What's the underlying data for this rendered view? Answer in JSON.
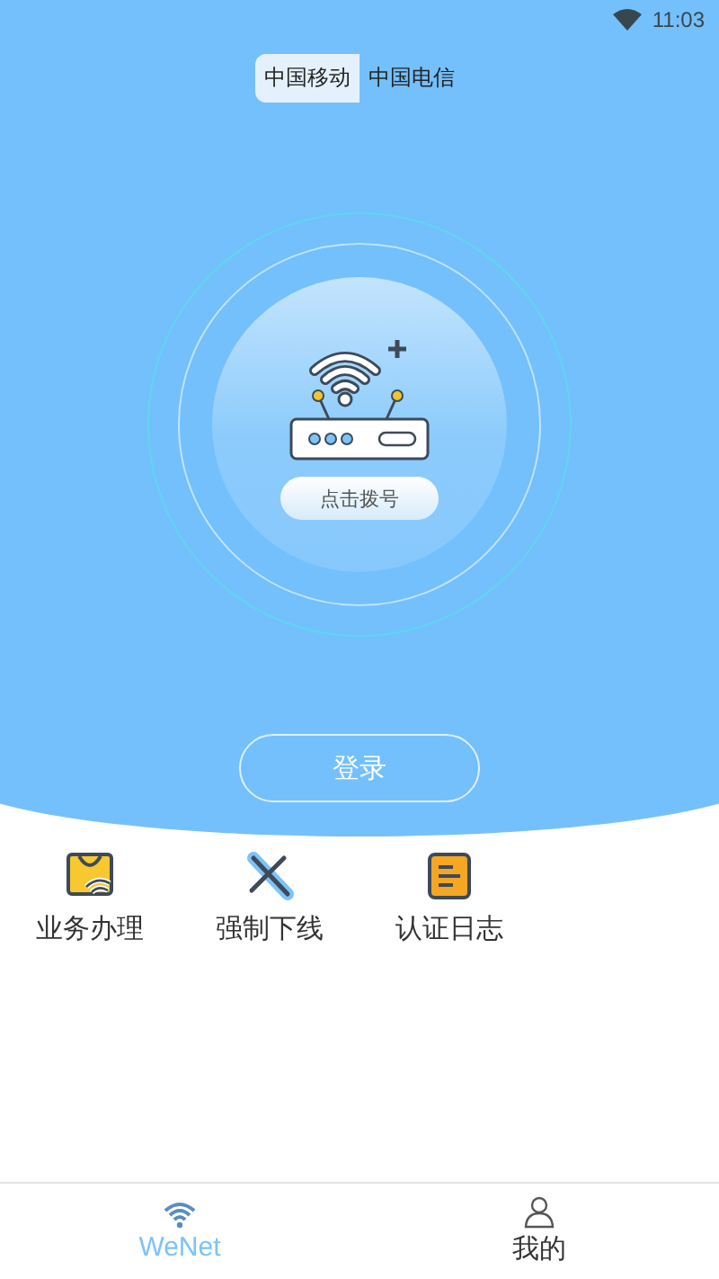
{
  "status_bar": {
    "time": "11:03"
  },
  "carrier_tabs": [
    {
      "label": "中国移动",
      "selected": true
    },
    {
      "label": "中国电信",
      "selected": false
    }
  ],
  "dial_button": "点击拨号",
  "login_button": "登录",
  "actions": [
    {
      "kind": "business",
      "label": "业务办理"
    },
    {
      "kind": "offline",
      "label": "强制下线"
    },
    {
      "kind": "log",
      "label": "认证日志"
    }
  ],
  "bottom_nav": [
    {
      "kind": "wifi",
      "label": "WeNet",
      "selected": true
    },
    {
      "kind": "user",
      "label": "我的",
      "selected": false
    }
  ]
}
